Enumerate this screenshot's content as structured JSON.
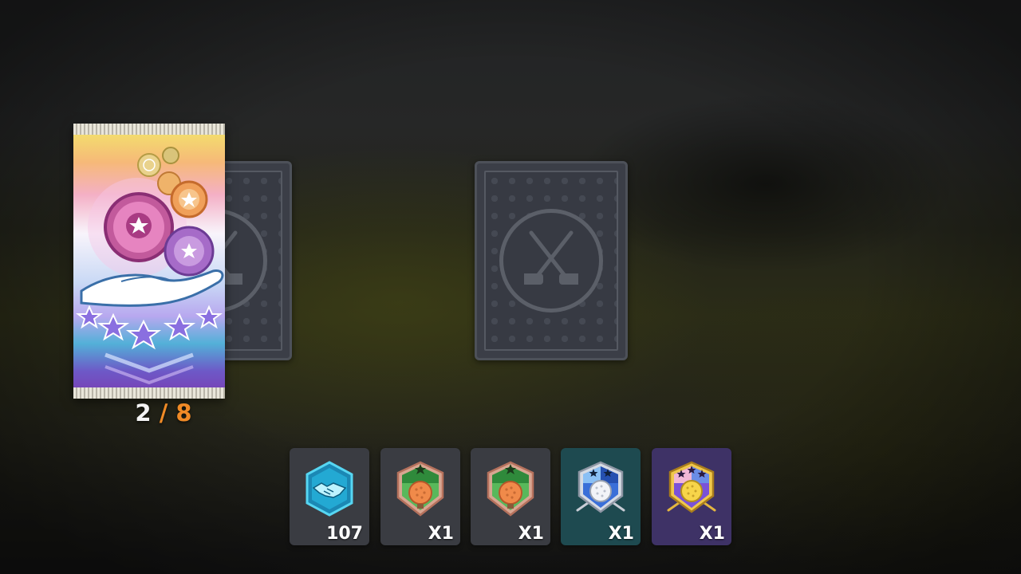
{
  "pack": {
    "opened": "2",
    "separator": "/",
    "total": "8",
    "colors": {
      "opened": "#f4f4f4",
      "total": "#f08a26"
    }
  },
  "card_backs": [
    {
      "icon": "crossed-golf-clubs-icon"
    },
    {
      "icon": "crossed-golf-clubs-icon"
    }
  ],
  "rewards": [
    {
      "icon": "handshake-badge-icon",
      "quantity": "107",
      "tint": "#3a3c42"
    },
    {
      "icon": "orange-golf-ball-green-shield-icon",
      "quantity": "X1",
      "tint": "#3a3c42"
    },
    {
      "icon": "orange-golf-ball-green-shield-icon",
      "quantity": "X1",
      "tint": "#3a3c42"
    },
    {
      "icon": "white-golf-ball-blue-shield-icon",
      "quantity": "X1",
      "tint": "#1e4a50"
    },
    {
      "icon": "yellow-golf-ball-purple-shield-icon",
      "quantity": "X1",
      "tint": "#3e3266"
    }
  ]
}
